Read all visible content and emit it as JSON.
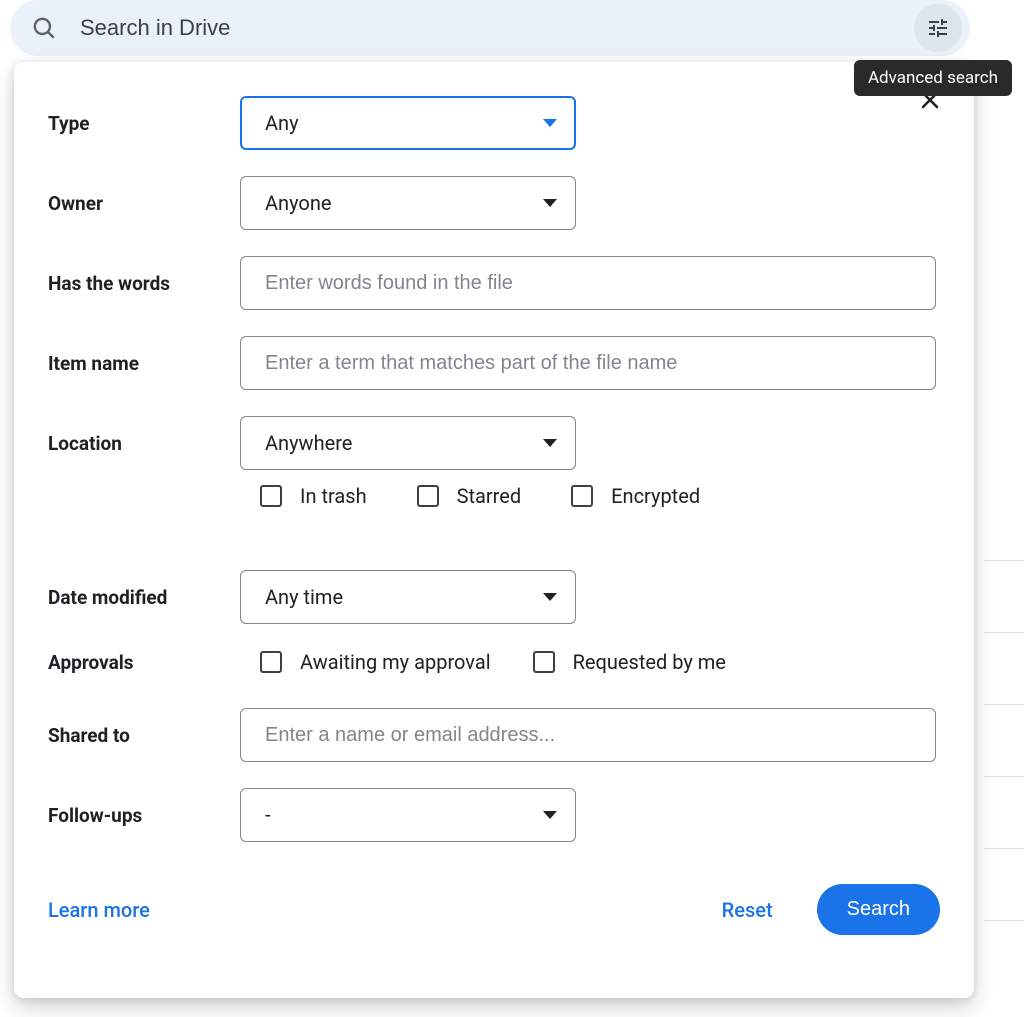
{
  "search": {
    "placeholder": "Search in Drive"
  },
  "tooltip": "Advanced search",
  "form": {
    "type": {
      "label": "Type",
      "value": "Any"
    },
    "owner": {
      "label": "Owner",
      "value": "Anyone"
    },
    "has_words": {
      "label": "Has the words",
      "placeholder": "Enter words found in the file"
    },
    "item_name": {
      "label": "Item name",
      "placeholder": "Enter a term that matches part of the file name"
    },
    "location": {
      "label": "Location",
      "value": "Anywhere",
      "checkboxes": {
        "in_trash": "In trash",
        "starred": "Starred",
        "encrypted": "Encrypted"
      }
    },
    "date_modified": {
      "label": "Date modified",
      "value": "Any time"
    },
    "approvals": {
      "label": "Approvals",
      "checkboxes": {
        "awaiting": "Awaiting my approval",
        "requested": "Requested by me"
      }
    },
    "shared_to": {
      "label": "Shared to",
      "placeholder": "Enter a name or email address..."
    },
    "follow_ups": {
      "label": "Follow-ups",
      "value": "-"
    }
  },
  "footer": {
    "learn_more": "Learn more",
    "reset": "Reset",
    "search": "Search"
  }
}
